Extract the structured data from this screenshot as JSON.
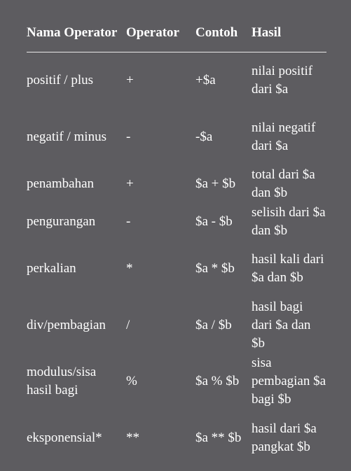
{
  "header": {
    "col_name": "Nama Operator",
    "col_operator": "Operator",
    "col_example": "Contoh",
    "col_result": "Hasil"
  },
  "rows": [
    {
      "name": "positif / plus",
      "operator": "+",
      "example": "+$a",
      "result": "nilai positif dari $a"
    },
    {
      "name": "negatif / minus",
      "operator": "-",
      "example": "-$a",
      "result": "nilai negatif dari $a"
    },
    {
      "name": "penambahan",
      "operator": "+",
      "example": "$a + $b",
      "result": "total dari $a dan $b"
    },
    {
      "name": "pengurangan",
      "operator": "-",
      "example": "$a - $b",
      "result": "selisih dari $a dan $b"
    },
    {
      "name": "perkalian",
      "operator": "*",
      "example": "$a * $b",
      "result": "hasil kali dari $a dan $b"
    },
    {
      "name": "div/pembagian",
      "operator": "/",
      "example": "$a / $b",
      "result": "hasil bagi dari $a dan $b"
    },
    {
      "name": "modulus/sisa hasil bagi",
      "operator": "%",
      "example": "$a % $b",
      "result": "sisa pembagian $a bagi $b"
    },
    {
      "name": "eksponensial*",
      "operator": "**",
      "example": "$a ** $b",
      "result": "hasil dari $a pangkat $b"
    }
  ]
}
